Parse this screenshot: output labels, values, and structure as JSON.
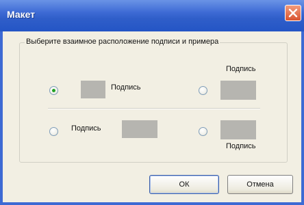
{
  "window": {
    "title": "Макет",
    "close_icon": "close-icon"
  },
  "group": {
    "legend": "Выберите взаимное расположение подписи и примера"
  },
  "options": [
    {
      "label": "Подпись",
      "checked": true
    },
    {
      "label": "Подпись",
      "checked": false
    },
    {
      "label": "Подпись",
      "checked": false
    },
    {
      "label": "Подпись",
      "checked": false
    }
  ],
  "buttons": {
    "ok": "ОК",
    "cancel": "Отмена"
  },
  "colors": {
    "title_bar": "#2f5ec9",
    "dialog_bg": "#f2efe3",
    "sample": "#b6b5b0",
    "radio_dot": "#21a121",
    "close_button": "#d9532f"
  }
}
